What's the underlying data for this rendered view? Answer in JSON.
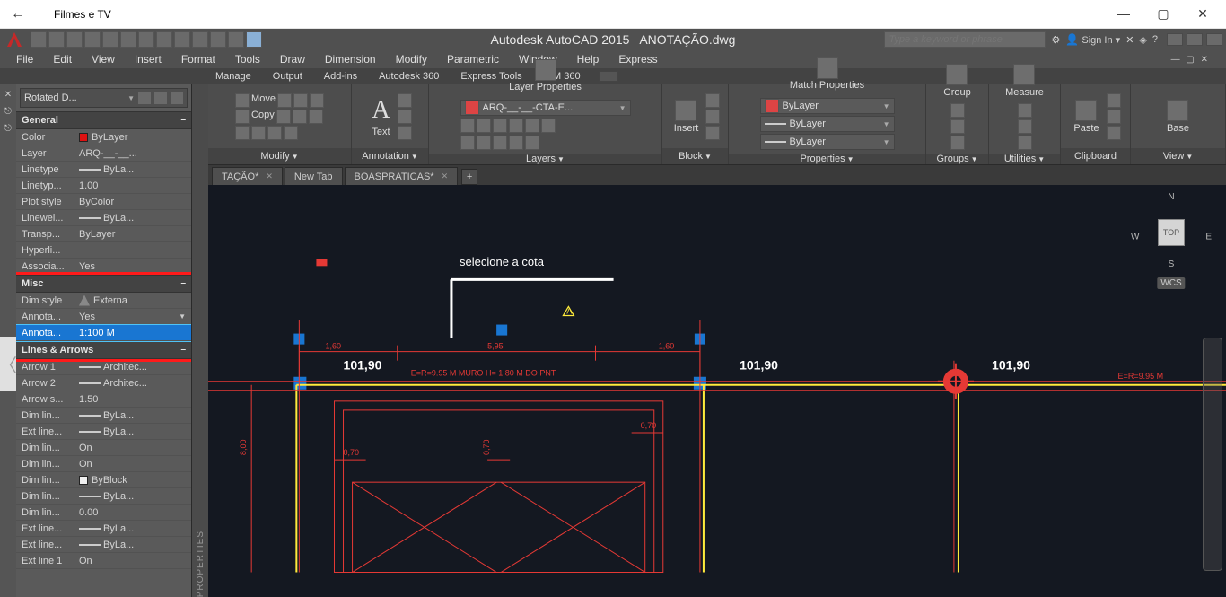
{
  "windows_app": {
    "title": "Filmes e TV"
  },
  "app": {
    "product": "Autodesk AutoCAD 2015",
    "document": "ANOTAÇÃO.dwg",
    "search_placeholder": "Type a keyword or phrase",
    "signin": "Sign In"
  },
  "main_menu": [
    "File",
    "Edit",
    "View",
    "Insert",
    "Format",
    "Tools",
    "Draw",
    "Dimension",
    "Modify",
    "Parametric",
    "Window",
    "Help",
    "Express"
  ],
  "ribbon_tabs": [
    "Manage",
    "Output",
    "Add-ins",
    "Autodesk 360",
    "Express Tools",
    "BIM 360"
  ],
  "ribbon_panels": {
    "modify": {
      "title": "Modify",
      "move": "Move",
      "copy": "Copy"
    },
    "annotation": {
      "title": "Annotation",
      "text": "Text"
    },
    "layers": {
      "title": "Layers",
      "btn": "Layer\nProperties",
      "combo": "ARQ-__-__-CTA-E..."
    },
    "block": {
      "title": "Block",
      "btn": "Insert"
    },
    "properties": {
      "title": "Properties",
      "btn": "Match\nProperties",
      "combo1": "ByLayer",
      "combo2": "ByLayer",
      "combo3": "ByLayer"
    },
    "groups": {
      "title": "Groups",
      "btn": "Group"
    },
    "utilities": {
      "title": "Utilities",
      "btn": "Measure"
    },
    "clipboard": {
      "title": "Clipboard",
      "btn": "Paste"
    },
    "view": {
      "title": "View",
      "btn": "Base"
    }
  },
  "doc_tabs": [
    "TAÇÃO*",
    "New Tab",
    "BOASPRATICAS*"
  ],
  "properties_panel_label": "PROPERTIES",
  "props_header": {
    "selection": "Rotated  D..."
  },
  "props": {
    "general": {
      "title": "General",
      "rows": [
        {
          "k": "Color",
          "v": "ByLayer",
          "swatch": "red"
        },
        {
          "k": "Layer",
          "v": "ARQ-__-__..."
        },
        {
          "k": "Linetype",
          "v": "ByLa...",
          "line": true
        },
        {
          "k": "Linetyp...",
          "v": "1.00"
        },
        {
          "k": "Plot style",
          "v": "ByColor"
        },
        {
          "k": "Linewei...",
          "v": "ByLa...",
          "line": true
        },
        {
          "k": "Transp...",
          "v": "ByLayer"
        },
        {
          "k": "Hyperli...",
          "v": ""
        },
        {
          "k": "Associa...",
          "v": "Yes"
        }
      ]
    },
    "misc": {
      "title": "Misc",
      "dim_style_k": "Dim style",
      "dim_style_v": "Externa",
      "annotative_k": "Annota...",
      "annotative_v": "Yes",
      "annoscale_k": "Annota...",
      "annoscale_v": "1:100 M"
    },
    "lines_arrows": {
      "title": "Lines & Arrows",
      "rows": [
        {
          "k": "Arrow 1",
          "v": "Architec...",
          "line": true
        },
        {
          "k": "Arrow 2",
          "v": "Architec...",
          "line": true
        },
        {
          "k": "Arrow s...",
          "v": "1.50"
        },
        {
          "k": "Dim lin...",
          "v": "ByLa...",
          "line": true
        },
        {
          "k": "Ext line...",
          "v": "ByLa...",
          "line": true
        },
        {
          "k": "Dim lin...",
          "v": "On"
        },
        {
          "k": "Dim lin...",
          "v": "On"
        },
        {
          "k": "Dim lin...",
          "v": "ByBlock",
          "swatch": "white"
        },
        {
          "k": "Dim lin...",
          "v": "ByLa...",
          "line": true
        },
        {
          "k": "Dim lin...",
          "v": "0.00"
        },
        {
          "k": "Ext line...",
          "v": "ByLa...",
          "line": true
        },
        {
          "k": "Ext line...",
          "v": "ByLa...",
          "line": true
        },
        {
          "k": "Ext line 1",
          "v": "On"
        }
      ]
    }
  },
  "canvas": {
    "tooltip": "selecione a cota",
    "dim_left": "101,90",
    "dim_mid": "101,90",
    "dim_right": "101,90",
    "dim_small1": "1,60",
    "dim_small2": "5,95",
    "dim_small3": "1,60",
    "dim_v": "8,00",
    "dim_a": "0,70",
    "note_center": "E=R=9.95 M MURO H= 1.80 M DO PNT",
    "note_right": "E=R=9.95 M",
    "viewcube": {
      "top": "TOP",
      "n": "N",
      "s": "S",
      "e": "E",
      "w": "W",
      "wcs": "WCS"
    }
  }
}
